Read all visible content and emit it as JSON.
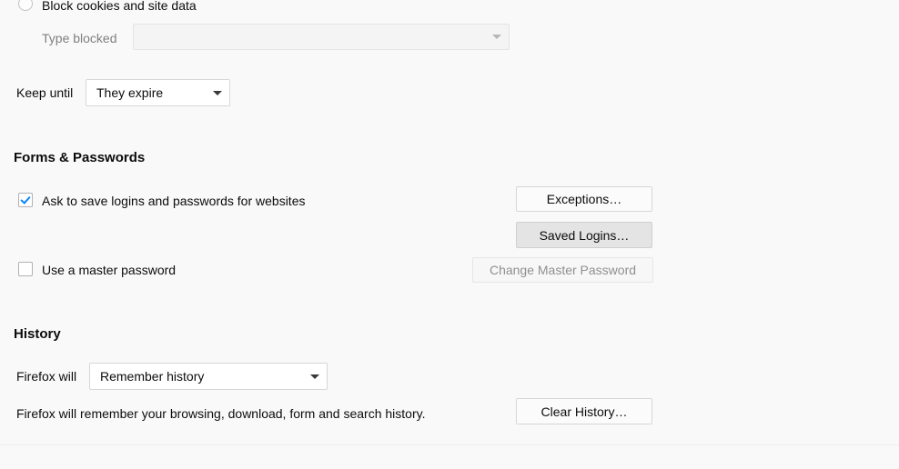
{
  "cookies": {
    "block_cookies_label": "Block cookies and site data",
    "block_cookies_radio_selected": false,
    "type_blocked_label": "Type blocked",
    "type_blocked_value": "",
    "type_blocked_disabled": true,
    "keep_until_label": "Keep until",
    "keep_until_value": "They expire"
  },
  "forms_passwords": {
    "heading": "Forms & Passwords",
    "ask_to_save_label": "Ask to save logins and passwords for websites",
    "ask_to_save_checked": true,
    "exceptions_button": "Exceptions…",
    "saved_logins_button": "Saved Logins…",
    "use_master_password_label": "Use a master password",
    "use_master_password_checked": false,
    "change_master_password_button": "Change Master Password",
    "change_master_password_disabled": true
  },
  "history": {
    "heading": "History",
    "firefox_will_label": "Firefox will",
    "mode_value": "Remember history",
    "description": "Firefox will remember your browsing, download, form and search history.",
    "clear_history_button": "Clear History…"
  },
  "colors": {
    "background": "#f9f9fa",
    "text": "#0c0c0d",
    "disabled_text": "#8f8f91",
    "accent_check": "#0a84ff",
    "border": "#d7d7db"
  }
}
